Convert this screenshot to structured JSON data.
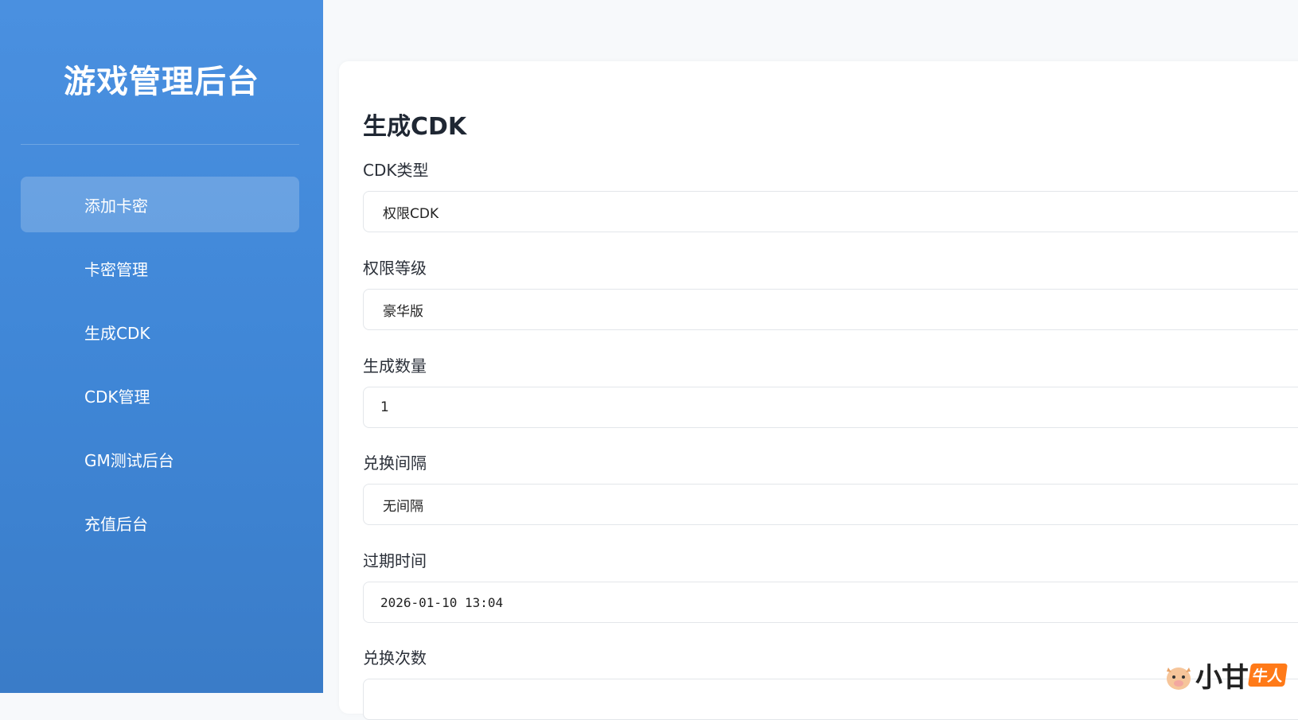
{
  "sidebar": {
    "brand": "游戏管理后台",
    "items": [
      {
        "label": "添加卡密",
        "active": true
      },
      {
        "label": "卡密管理",
        "active": false
      },
      {
        "label": "生成CDK",
        "active": false
      },
      {
        "label": "CDK管理",
        "active": false
      },
      {
        "label": "GM测试后台",
        "active": false
      },
      {
        "label": "充值后台",
        "active": false
      }
    ]
  },
  "main": {
    "title": "生成CDK",
    "fields": [
      {
        "label": "CDK类型",
        "value": "权限CDK"
      },
      {
        "label": "权限等级",
        "value": "豪华版"
      },
      {
        "label": "生成数量",
        "value": "1"
      },
      {
        "label": "兑换间隔",
        "value": "无间隔"
      },
      {
        "label": "过期时间",
        "value": "2026-01-10 13:04"
      },
      {
        "label": "兑换次数",
        "value": ""
      }
    ]
  },
  "watermark": {
    "text": "小甘",
    "badge": "牛人"
  },
  "colors": {
    "sidebar_top": "#4a90e0",
    "sidebar_bottom": "#3a7cc8",
    "page_bg": "#f7f9fb",
    "card_bg": "#ffffff",
    "border": "#e3e6ea",
    "badge": "#ff7a18"
  }
}
